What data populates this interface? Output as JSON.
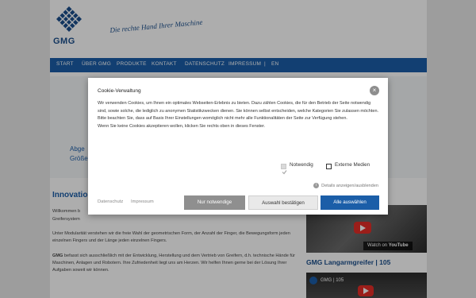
{
  "brand": {
    "logo_text": "GMG",
    "slogan": "Die rechte Hand Ihrer Maschine"
  },
  "nav": {
    "items": [
      "START",
      "ÜBER GMG",
      "PRODUKTE",
      "KONTAKT",
      "DATENSCHUTZ",
      "IMPRESSUM",
      "|",
      "EN"
    ]
  },
  "hero": {
    "line1": "Abge",
    "line2": "Größe"
  },
  "content": {
    "heading": "Innovatio",
    "p1_a": "Willkommen b",
    "p1_b": "Greifersystem",
    "p2": "Unter Modularität verstehen wir die freie Wahl der geometrischen Form, der Anzahl der Finger, die Bewegungsform jeden einzelnen Fingers und der Länge jeden einzelnen Fingers.",
    "p3_bold": "GMG",
    "p3_rest": " befasst sich ausschließlich mit der Entwicklung, Herstellung und dem Vertrieb von Greifern, d.h. technische Hände für Maschinen, Anlagen und Robotern. Ihre Zufriedenheit liegt uns am Herzen. Wir helfen Ihnen gerne bei der Lösung Ihrer Aufgaben soweit wir können."
  },
  "videos": {
    "watch_on": "Watch on",
    "youtube": "YouTube",
    "title2": "GMG Langarmgreifer | 105",
    "embed2_label": "GMG | 105"
  },
  "cookie": {
    "title": "Cookie-Verwaltung",
    "text": "Wir verwenden Cookies, um Ihnen ein optimales Webseiten-Erlebnis zu bieten. Dazu zählen Cookies, die für den Betrieb der Seite notwendig sind, sowie solche, die lediglich zu anonymen Statistikzwecken dienen. Sie können selbst entscheiden, welche Kategorien Sie zulassen möchten. Bitte beachten Sie, dass auf Basis Ihrer Einstellungen womöglich nicht mehr alle Funktionalitäten der Seite zur Verfügung stehen.",
    "text2": "Wenn Sie keine Cookies akzeptieren wollen, klicken Sie rechts oben in dieses Fenster.",
    "opt_necessary": "Notwendig",
    "opt_external": "Externe Medien",
    "details": "Details anzeigen/ausblenden",
    "link_privacy": "Datenschutz",
    "link_imprint": "Impressum",
    "btn_necessary": "Nur notwendige",
    "btn_confirm": "Auswahl bestätigen",
    "btn_all": "Alle auswählen",
    "close_glyph": "×",
    "info_glyph": "i",
    "necessary_checked": true,
    "external_checked": false
  },
  "colors": {
    "nav_blue": "#1b5ea8",
    "brand_blue": "#1b4f8c",
    "button_gray": "#8f8f8f"
  }
}
